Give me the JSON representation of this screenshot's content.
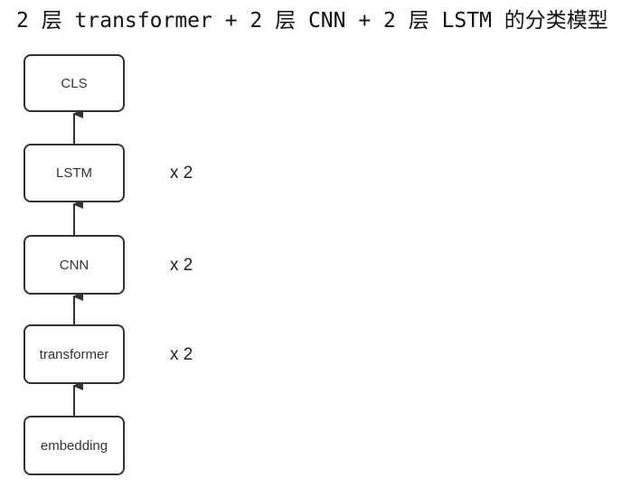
{
  "title": "2 层 transformer + 2 层 CNN + 2 层 LSTM 的分类模型",
  "blocks": {
    "cls": "CLS",
    "lstm": "LSTM",
    "cnn": "CNN",
    "transformer": "transformer",
    "embedding": "embedding"
  },
  "repeats": {
    "lstm": "x 2",
    "cnn": "x 2",
    "transformer": "x 2"
  },
  "flow": [
    "embedding",
    "transformer",
    "CNN",
    "LSTM",
    "CLS"
  ],
  "colors": {
    "border": "#333333",
    "arrow": "#333333",
    "text": "#333333"
  }
}
